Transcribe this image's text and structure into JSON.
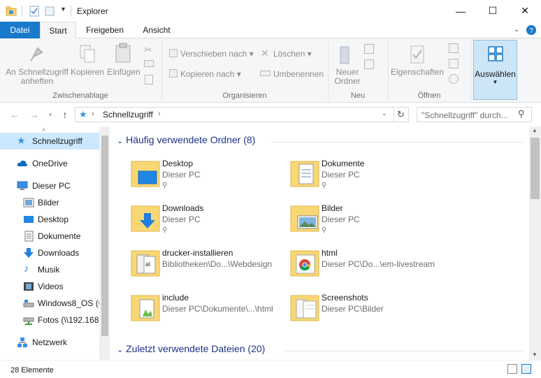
{
  "window": {
    "title": "Explorer",
    "controls": {
      "minimize": "—",
      "maximize": "☐",
      "close": "✕"
    }
  },
  "ribbon": {
    "tabs": [
      {
        "label": "Datei"
      },
      {
        "label": "Start"
      },
      {
        "label": "Freigeben"
      },
      {
        "label": "Ansicht"
      }
    ],
    "groups": {
      "clipboard": {
        "label": "Zwischenablage",
        "pin_line1": "An Schnellzugriff",
        "pin_line2": "anheften",
        "copy": "Kopieren",
        "paste": "Einfügen"
      },
      "organize": {
        "label": "Organisieren",
        "move_to": "Verschieben nach",
        "copy_to": "Kopieren nach",
        "delete": "Löschen",
        "rename": "Umbenennen"
      },
      "new": {
        "label": "Neu",
        "new_folder_line1": "Neuer",
        "new_folder_line2": "Ordner"
      },
      "open": {
        "label": "Öffnen",
        "properties": "Eigenschaften"
      },
      "select": {
        "label": "Auswählen"
      }
    }
  },
  "address": {
    "path": "Schnellzugriff",
    "search_placeholder": "\"Schnellzugriff\" durch..."
  },
  "navigation": {
    "items": [
      {
        "label": "Schnellzugriff",
        "icon": "star-icon",
        "selected": true
      },
      {
        "label": "OneDrive",
        "icon": "cloud-icon"
      },
      {
        "label": "Dieser PC",
        "icon": "computer-icon"
      },
      {
        "label": "Bilder",
        "icon": "pictures-icon"
      },
      {
        "label": "Desktop",
        "icon": "desktop-icon"
      },
      {
        "label": "Dokumente",
        "icon": "documents-icon"
      },
      {
        "label": "Downloads",
        "icon": "download-icon"
      },
      {
        "label": "Musik",
        "icon": "music-icon"
      },
      {
        "label": "Videos",
        "icon": "video-icon"
      },
      {
        "label": "Windows8_OS (C",
        "icon": "drive-icon"
      },
      {
        "label": "Fotos (\\\\192.168",
        "icon": "network-drive-icon"
      },
      {
        "label": "Netzwerk",
        "icon": "network-icon"
      }
    ]
  },
  "content": {
    "frequent_header": "Häufig verwendete Ordner (8)",
    "recent_header": "Zuletzt verwendete Dateien (20)",
    "folders": [
      {
        "name": "Desktop",
        "path": "Dieser PC",
        "pinned": true
      },
      {
        "name": "Dokumente",
        "path": "Dieser PC",
        "pinned": true
      },
      {
        "name": "Downloads",
        "path": "Dieser PC",
        "pinned": true
      },
      {
        "name": "Bilder",
        "path": "Dieser PC",
        "pinned": true
      },
      {
        "name": "drucker-installieren",
        "path": "Bibliotheken\\Do...\\Webdesign",
        "pinned": false
      },
      {
        "name": "html",
        "path": "Dieser PC\\Do...\\em-livestream",
        "pinned": false
      },
      {
        "name": "include",
        "path": "Dieser PC\\Dokumente\\...\\html",
        "pinned": false
      },
      {
        "name": "Screenshots",
        "path": "Dieser PC\\Bilder",
        "pinned": false
      }
    ]
  },
  "status": {
    "item_count": "28 Elemente"
  },
  "colors": {
    "accent": "#1979ca",
    "selection": "#cce8ff",
    "header_text": "#1e3287",
    "folder": "#f8d775"
  }
}
